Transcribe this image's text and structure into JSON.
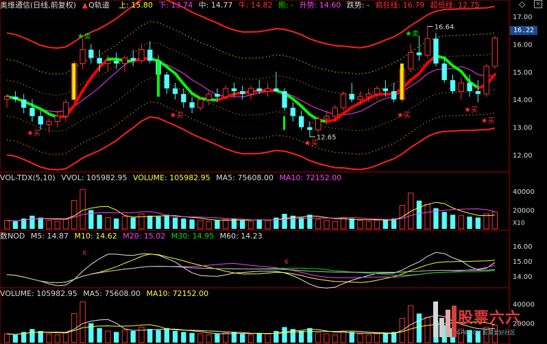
{
  "header": {
    "stock": "奥维通信(日线,前复权)",
    "indicator": "Q轨道",
    "up": "上: 15.80",
    "down": "下: 13.74",
    "mid": "中: 14.77",
    "bull": "牛: 14.82",
    "bear": "熊: -",
    "rise": "升势: 14.60",
    "fall": "跌势: -",
    "crazy": "疯狂线: 16.79",
    "oversold": "超低线: 12.75"
  },
  "vol_header": {
    "name": "VOL-TDX(5,10)",
    "vvol": "VVOL: 105982.95",
    "volume": "VOLUME: 105982.95",
    "ma5": "MA5: 75608.00",
    "ma10": "MA10: 72152.00"
  },
  "ma_header": {
    "name": "数NOD",
    "m5": "M5: 14.87",
    "m10": "M10: 14.62",
    "m20": "M20: 15.02",
    "m30": "M30: 14.95",
    "m60": "M60: 14.23"
  },
  "vol2_header": {
    "volume": "VOLUME: 105982.95",
    "ma5": "MA5: 75608.00",
    "ma10": "MA10: 72152.00"
  },
  "current_price": "16.22",
  "annotations": {
    "buy": "买",
    "sell": "卖",
    "high": "16.64",
    "low": "12.65",
    "six": "6",
    "x10": "X10"
  },
  "watermark": {
    "title": "股票六六",
    "sub": "GP66.CN 股票爱好社区"
  },
  "colors": {
    "up": "#ff3232",
    "down": "#54fcfc",
    "band": "#ff2020",
    "dots_orange": "#e8a000",
    "dots_gold": "#d8d000",
    "buy_line": "#ff0000",
    "sell_line": "#00ff00",
    "signal": "#ffe000"
  },
  "chart_data": [
    {
      "type": "candlestick",
      "title": "奥维通信(日线,前复权)",
      "y_ticks": [
        12.0,
        13.0,
        14.0,
        15.0,
        16.0,
        17.0
      ],
      "ylim": [
        11.7,
        17.3
      ],
      "candles": [
        [
          14.0,
          14.2,
          13.7,
          14.1
        ],
        [
          14.1,
          14.3,
          13.9,
          14.0
        ],
        [
          14.0,
          14.2,
          13.5,
          13.7
        ],
        [
          13.7,
          14.0,
          13.2,
          13.4
        ],
        [
          13.4,
          13.6,
          12.9,
          13.1
        ],
        [
          13.1,
          13.3,
          12.8,
          13.2
        ],
        [
          13.2,
          13.6,
          13.0,
          13.4
        ],
        [
          13.4,
          14.0,
          13.2,
          13.9
        ],
        [
          14.0,
          15.4,
          13.9,
          15.3
        ],
        [
          15.3,
          16.2,
          15.1,
          15.8
        ],
        [
          15.8,
          16.0,
          15.3,
          15.5
        ],
        [
          15.5,
          15.8,
          15.0,
          15.3
        ],
        [
          15.3,
          15.6,
          15.0,
          15.4
        ],
        [
          15.4,
          15.7,
          15.1,
          15.3
        ],
        [
          15.3,
          15.6,
          15.0,
          15.5
        ],
        [
          15.5,
          15.8,
          15.2,
          15.4
        ],
        [
          15.4,
          16.0,
          15.3,
          15.8
        ],
        [
          15.8,
          16.1,
          15.3,
          15.4
        ],
        [
          15.4,
          15.6,
          14.8,
          14.9
        ],
        [
          14.9,
          15.0,
          14.2,
          14.4
        ],
        [
          14.4,
          14.6,
          14.0,
          14.2
        ],
        [
          14.2,
          14.4,
          13.7,
          13.9
        ],
        [
          13.9,
          14.1,
          13.5,
          13.7
        ],
        [
          13.7,
          14.1,
          13.6,
          14.0
        ],
        [
          14.0,
          14.3,
          13.8,
          14.2
        ],
        [
          14.2,
          14.4,
          13.9,
          14.1
        ],
        [
          14.1,
          14.5,
          14.0,
          14.4
        ],
        [
          14.4,
          14.6,
          14.1,
          14.3
        ],
        [
          14.3,
          14.5,
          14.0,
          14.2
        ],
        [
          14.2,
          14.5,
          14.0,
          14.4
        ],
        [
          14.4,
          14.7,
          14.2,
          14.3
        ],
        [
          14.3,
          14.6,
          14.1,
          14.4
        ],
        [
          14.4,
          15.0,
          14.3,
          14.3
        ],
        [
          14.3,
          14.4,
          13.6,
          13.7
        ],
        [
          13.7,
          13.9,
          13.2,
          13.4
        ],
        [
          13.4,
          13.6,
          12.9,
          13.0
        ],
        [
          13.0,
          13.2,
          12.65,
          12.9
        ],
        [
          12.9,
          13.4,
          12.8,
          13.3
        ],
        [
          13.3,
          13.6,
          13.1,
          13.4
        ],
        [
          13.4,
          13.8,
          13.2,
          13.7
        ],
        [
          13.7,
          14.3,
          13.6,
          14.2
        ],
        [
          14.2,
          14.6,
          13.9,
          14.0
        ],
        [
          14.0,
          14.3,
          13.8,
          14.1
        ],
        [
          14.1,
          14.4,
          13.9,
          14.2
        ],
        [
          14.2,
          14.5,
          14.0,
          14.4
        ],
        [
          14.4,
          14.7,
          14.1,
          14.3
        ],
        [
          14.3,
          14.6,
          13.9,
          14.0
        ],
        [
          14.0,
          15.2,
          13.9,
          15.1
        ],
        [
          15.1,
          16.0,
          15.0,
          15.7
        ],
        [
          15.7,
          16.3,
          15.4,
          15.6
        ],
        [
          15.6,
          16.64,
          15.5,
          16.2
        ],
        [
          16.2,
          16.4,
          15.2,
          15.3
        ],
        [
          15.3,
          15.5,
          14.6,
          14.7
        ],
        [
          14.7,
          14.9,
          14.2,
          14.3
        ],
        [
          14.3,
          14.8,
          14.0,
          14.6
        ],
        [
          14.6,
          14.9,
          14.1,
          14.3
        ],
        [
          14.3,
          14.7,
          13.9,
          14.2
        ],
        [
          14.2,
          15.3,
          14.1,
          15.2
        ],
        [
          15.2,
          16.3,
          15.1,
          16.22
        ]
      ]
    },
    {
      "type": "bar",
      "title": "VOL-TDX(5,10)",
      "y_ticks": [
        20000,
        40000
      ],
      "ylim": [
        0,
        48000
      ],
      "values": [
        9000,
        8000,
        11000,
        14000,
        12000,
        9000,
        8000,
        10000,
        30000,
        42000,
        20000,
        15000,
        12000,
        11000,
        13000,
        12000,
        16000,
        14000,
        13000,
        15000,
        12000,
        11000,
        10000,
        9000,
        8000,
        9000,
        10000,
        11000,
        9000,
        8000,
        10000,
        9000,
        12000,
        16000,
        14000,
        12000,
        15000,
        10000,
        9000,
        8000,
        12000,
        11000,
        9000,
        8000,
        9000,
        10000,
        11000,
        25000,
        38000,
        30000,
        26000,
        22000,
        18000,
        15000,
        14000,
        13000,
        12000,
        16000,
        18000
      ]
    },
    {
      "type": "line",
      "title": "数NOD",
      "y_ticks": [
        14.0,
        15.0,
        16.0
      ],
      "ylim": [
        13.4,
        16.6
      ]
    },
    {
      "type": "bar",
      "title": "VOLUME",
      "y_ticks": [
        20000,
        40000
      ],
      "ylim": [
        0,
        48000
      ]
    }
  ]
}
